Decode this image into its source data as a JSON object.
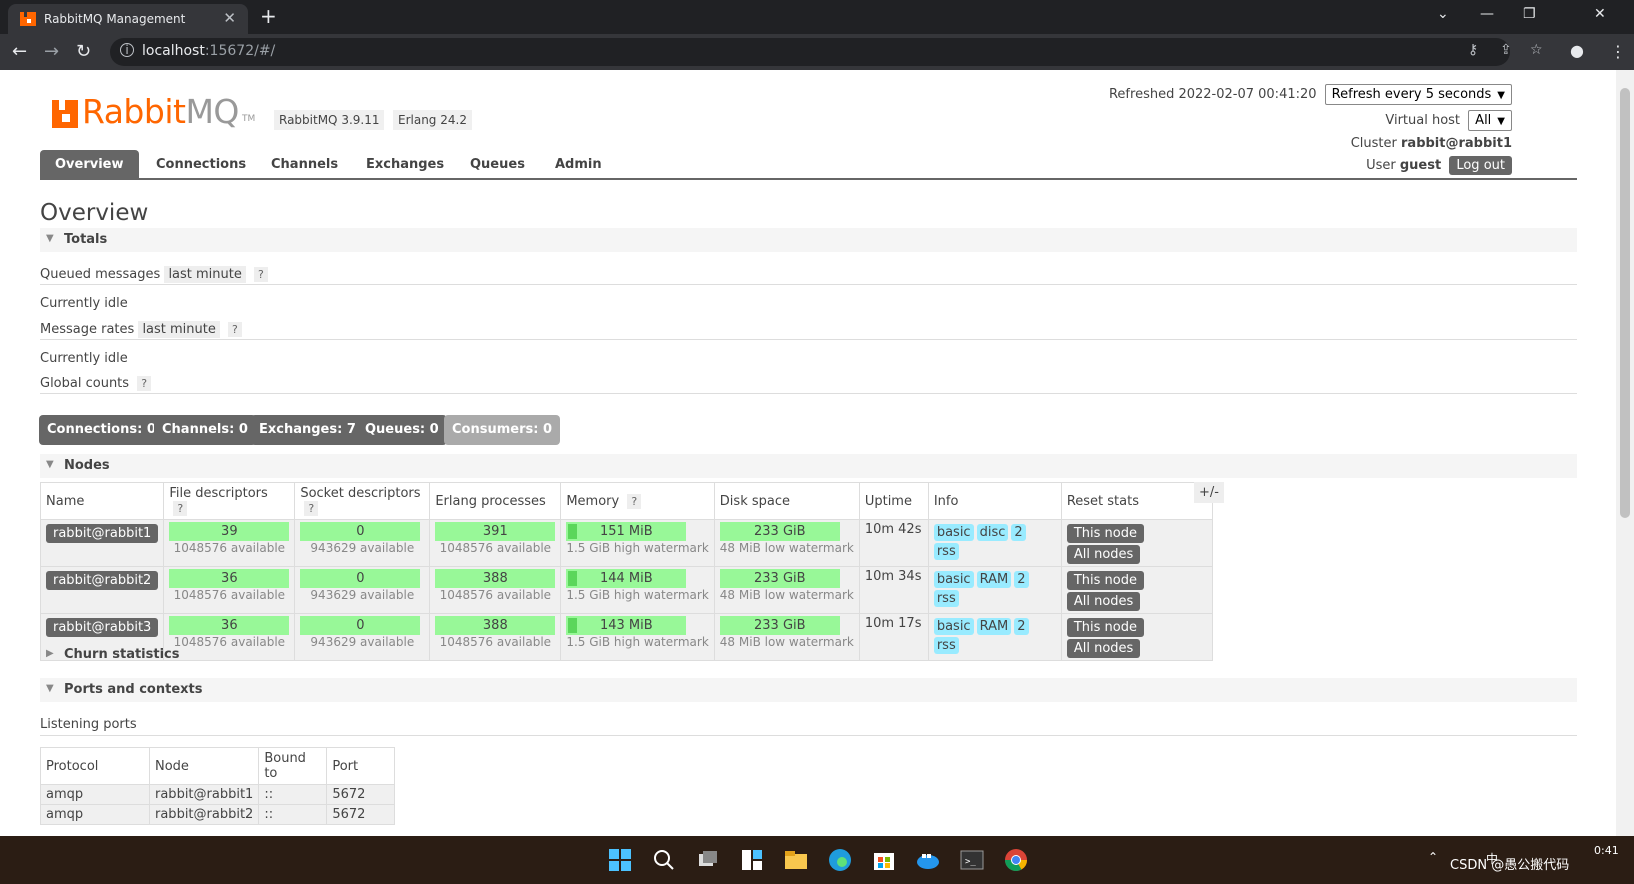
{
  "browser": {
    "tab_title": "RabbitMQ Management",
    "url_host": "localhost",
    "url_rest": ":15672/#/"
  },
  "header": {
    "brand_rabbit": "Rabbit",
    "brand_mq": "MQ",
    "brand_tm": "TM",
    "version_rabbit": "RabbitMQ 3.9.11",
    "version_erlang": "Erlang 24.2",
    "refreshed_label": "Refreshed 2022-02-07 00:41:20",
    "refresh_select": "Refresh every 5 seconds",
    "vhost_label": "Virtual host",
    "vhost_select": "All",
    "cluster_label": "Cluster",
    "cluster_name": "rabbit@rabbit1",
    "user_label": "User",
    "user_name": "guest",
    "logout": "Log out"
  },
  "menu": [
    "Overview",
    "Connections",
    "Channels",
    "Exchanges",
    "Queues",
    "Admin"
  ],
  "page_title": "Overview",
  "totals": {
    "section": "Totals",
    "queued_label": "Queued messages",
    "queued_range": "last minute",
    "help": "?",
    "idle1": "Currently idle",
    "rates_label": "Message rates",
    "rates_range": "last minute",
    "idle2": "Currently idle",
    "global_label": "Global counts"
  },
  "counts": [
    {
      "label": "Connections:",
      "value": "0"
    },
    {
      "label": "Channels:",
      "value": "0"
    },
    {
      "label": "Exchanges:",
      "value": "7"
    },
    {
      "label": "Queues:",
      "value": "0"
    },
    {
      "label": "Consumers:",
      "value": "0"
    }
  ],
  "nodes": {
    "section": "Nodes",
    "columns": [
      "Name",
      "File descriptors",
      "Socket descriptors",
      "Erlang processes",
      "Memory",
      "Disk space",
      "Uptime",
      "Info",
      "Reset stats"
    ],
    "plusminus": "+/-",
    "rows": [
      {
        "name": "rabbit@rabbit1",
        "fd": "39",
        "fd_avail": "1048576 available",
        "sd": "0",
        "sd_avail": "943629 available",
        "ep": "391",
        "ep_avail": "1048576 available",
        "mem": "151 MiB",
        "mem_wm": "1.5 GiB high watermark",
        "disk": "233 GiB",
        "disk_wm": "48 MiB low watermark",
        "uptime": "10m 42s",
        "info": [
          "basic",
          "disc",
          "2",
          "rss"
        ],
        "this_node": "This node",
        "all_nodes": "All nodes"
      },
      {
        "name": "rabbit@rabbit2",
        "fd": "36",
        "fd_avail": "1048576 available",
        "sd": "0",
        "sd_avail": "943629 available",
        "ep": "388",
        "ep_avail": "1048576 available",
        "mem": "144 MiB",
        "mem_wm": "1.5 GiB high watermark",
        "disk": "233 GiB",
        "disk_wm": "48 MiB low watermark",
        "uptime": "10m 34s",
        "info": [
          "basic",
          "RAM",
          "2",
          "rss"
        ],
        "this_node": "This node",
        "all_nodes": "All nodes"
      },
      {
        "name": "rabbit@rabbit3",
        "fd": "36",
        "fd_avail": "1048576 available",
        "sd": "0",
        "sd_avail": "943629 available",
        "ep": "388",
        "ep_avail": "1048576 available",
        "mem": "143 MiB",
        "mem_wm": "1.5 GiB high watermark",
        "disk": "233 GiB",
        "disk_wm": "48 MiB low watermark",
        "uptime": "10m 17s",
        "info": [
          "basic",
          "RAM",
          "2",
          "rss"
        ],
        "this_node": "This node",
        "all_nodes": "All nodes"
      }
    ]
  },
  "churn": {
    "section": "Churn statistics"
  },
  "ports": {
    "section": "Ports and contexts",
    "listening": "Listening ports",
    "columns": [
      "Protocol",
      "Node",
      "Bound to",
      "Port"
    ],
    "rows": [
      {
        "protocol": "amqp",
        "node": "rabbit@rabbit1",
        "bound": "::",
        "port": "5672"
      },
      {
        "protocol": "amqp",
        "node": "rabbit@rabbit2",
        "bound": "::",
        "port": "5672"
      }
    ]
  },
  "taskbar": {
    "tray_text": "CSDN @愚公搬代码",
    "tray_time": "0:41",
    "tray_lang": "中"
  },
  "colors": {
    "brand": "#ff6600",
    "bar_green": "#98f898",
    "tag_blue": "#99ebff",
    "button_gray": "#666666"
  }
}
